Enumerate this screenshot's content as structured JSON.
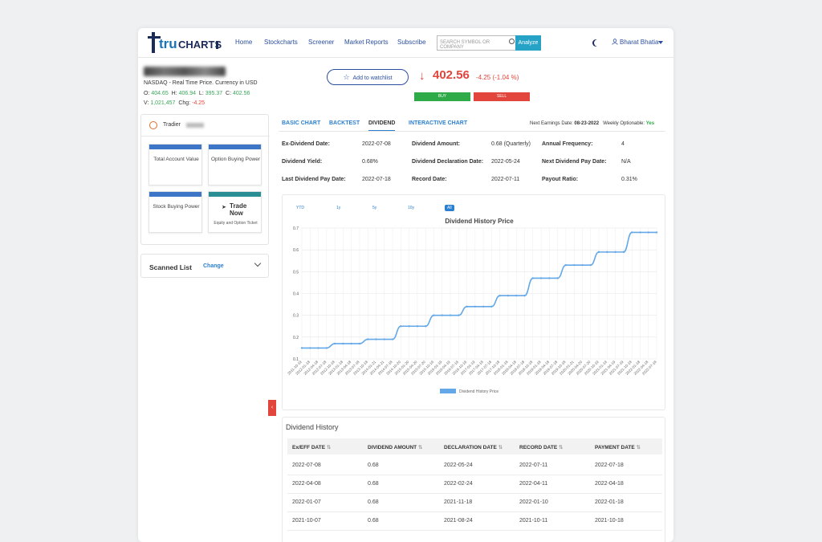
{
  "nav": {
    "logo_tru": "tru",
    "logo_charts": "CHARTS",
    "links": [
      "Home",
      "Stockcharts",
      "Screener",
      "Market Reports",
      "Subscribe"
    ],
    "search_placeholder": "SEARCH SYMBOL OR COMPANY",
    "analyze": "Analyze",
    "user": "Bharat Bhatia"
  },
  "quote": {
    "exchange_line": "NASDAQ - Real Time Price. Currency in USD",
    "o_label": "O:",
    "o": "404.65",
    "h_label": "H:",
    "h": "406.94",
    "l_label": "L:",
    "l": "395.37",
    "c_label": "C:",
    "c": "402.56",
    "v_label": "V:",
    "v": "1,021,457",
    "chg_label": "Chg:",
    "chg": "-4.25",
    "watchlist": "Add to watchlist",
    "price": "402.56",
    "change": "-4.25 (-1.04 %)",
    "buy": "BUY",
    "sell": "SELL"
  },
  "account": {
    "broker": "Tradier",
    "cards": [
      "Total Account Value",
      "Option Buying Power",
      "Stock Buying Power"
    ],
    "trade_title": "Trade Now",
    "trade_sub": "Equity and Option Ticket"
  },
  "scanned": {
    "title": "Scanned List",
    "change": "Change"
  },
  "tabs": [
    "BASIC CHART",
    "BACKTEST",
    "DIVIDEND",
    "INTERACTIVE CHART"
  ],
  "earnings": {
    "label": "Next Earnings Date:",
    "date": "08-23-2022",
    "weekly_label": "Weekly Optionable:",
    "weekly": "Yes"
  },
  "dividend_info": [
    {
      "label": "Ex-Dividend Date:",
      "value": "2022-07-08"
    },
    {
      "label": "Dividend Amount:",
      "value": "0.68 (Quarterly)"
    },
    {
      "label": "Annual Frequency:",
      "value": "4"
    },
    {
      "label": "Dividend Yield:",
      "value": "0.68%"
    },
    {
      "label": "Dividend Declaration Date:",
      "value": "2022-05-24"
    },
    {
      "label": "Next Dividend Pay Date:",
      "value": "N/A"
    },
    {
      "label": "Last Dividend Pay Date:",
      "value": "2022-07-18"
    },
    {
      "label": "Record Date:",
      "value": "2022-07-11"
    },
    {
      "label": "Payout Ratio:",
      "value": "0.31%"
    }
  ],
  "ranges": [
    "YTD",
    "1y",
    "5y",
    "10y",
    "All"
  ],
  "chart_data": {
    "type": "line",
    "title": "Dividend History Price",
    "legend": "Dividend History Price",
    "legend_position": "bottom",
    "ylim": [
      0.1,
      0.7
    ],
    "yticks": [
      "0.1",
      "0.2",
      "0.3",
      "0.4",
      "0.5",
      "0.6",
      "0.7"
    ],
    "grid": true,
    "color": "#64a8e8",
    "x": [
      "2011-10-19",
      "2012-01-18",
      "2012-04-18",
      "2012-07-18",
      "2012-10-18",
      "2013-01-18",
      "2013-04-18",
      "2013-07-18",
      "2013-10-18",
      "2014-01-21",
      "2014-04-21",
      "2014-07-18",
      "2014-10-20",
      "2015-01-20",
      "2015-04-20",
      "2015-07-20",
      "2015-10-19",
      "2016-01-19",
      "2016-04-19",
      "2016-07-19",
      "2016-10-19",
      "2017-01-19",
      "2017-04-18",
      "2017-07-18",
      "2017-10-18",
      "2018-01-18",
      "2018-04-18",
      "2018-07-18",
      "2018-10-18",
      "2019-01-18",
      "2019-04-18",
      "2019-07-18",
      "2019-10-18",
      "2020-01-21",
      "2020-04-20",
      "2020-07-20",
      "2020-10-19",
      "2021-01-19",
      "2021-04-19",
      "2021-07-19",
      "2021-10-18",
      "2022-01-18",
      "2022-04-18",
      "2022-07-18"
    ],
    "values": [
      0.15,
      0.15,
      0.15,
      0.15,
      0.17,
      0.17,
      0.17,
      0.17,
      0.19,
      0.19,
      0.19,
      0.19,
      0.25,
      0.25,
      0.25,
      0.25,
      0.3,
      0.3,
      0.3,
      0.3,
      0.34,
      0.34,
      0.34,
      0.34,
      0.39,
      0.39,
      0.39,
      0.39,
      0.47,
      0.47,
      0.47,
      0.47,
      0.53,
      0.53,
      0.53,
      0.53,
      0.59,
      0.59,
      0.59,
      0.59,
      0.68,
      0.68,
      0.68,
      0.68
    ]
  },
  "history": {
    "title": "Dividend History",
    "columns": [
      "Ex/EFF DATE",
      "DIVIDEND AMOUNT",
      "DECLARATION DATE",
      "RECORD DATE",
      "PAYMENT DATE"
    ],
    "sort_glyph": "⇅",
    "rows": [
      [
        "2022-07-08",
        "0.68",
        "2022-05-24",
        "2022-07-11",
        "2022-07-18"
      ],
      [
        "2022-04-08",
        "0.68",
        "2022-02-24",
        "2022-04-11",
        "2022-04-18"
      ],
      [
        "2022-01-07",
        "0.68",
        "2021-11-18",
        "2022-01-10",
        "2022-01-18"
      ],
      [
        "2021-10-07",
        "0.68",
        "2021-08-24",
        "2021-10-11",
        "2021-10-18"
      ]
    ]
  }
}
